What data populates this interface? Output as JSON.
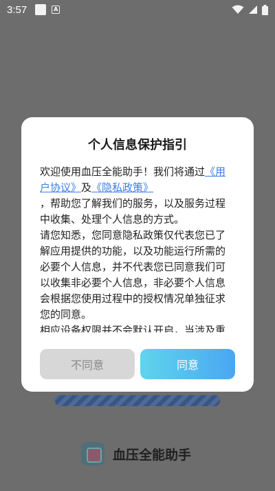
{
  "status_bar": {
    "time": "3:57",
    "icons": [
      "notification-square-icon",
      "keyboard-a-icon",
      "wifi-icon",
      "signal-icon",
      "battery-icon"
    ]
  },
  "background": {
    "progress": 1.0,
    "app_name": "血压全能助手",
    "logo_icon": "app-logo-icon"
  },
  "dialog": {
    "title": "个人信息保护指引",
    "intro_prefix": "欢迎使用血压全能助手！我们将通过",
    "user_agreement_link": "《用户协议》",
    "and_text": "及",
    "privacy_policy_link": "《隐私政策》",
    "intro_suffix": "，帮助您了解我们的服务，以及服务过程中收集、处理个人信息的方式。",
    "paragraph2": "请您知悉，您同意隐私政策仅代表您已了解应用提供的功能，以及功能运行所需的必要个人信息，并不代表您已同意我们可以收集非必要个人信息，非必要个人信息会根据您使用过程中的授权情况单独征求您的同意。",
    "paragraph3_partial": "相应设备权限并不会默认开启，当涉及重",
    "disagree_label": "不同意",
    "agree_label": "同意"
  },
  "colors": {
    "overlay": "#6d6d6d",
    "link": "#3b7fe0",
    "agree_gradient_start": "#5fd4ee",
    "agree_gradient_end": "#4aa7f2",
    "disagree_bg": "#d7d7d7"
  }
}
